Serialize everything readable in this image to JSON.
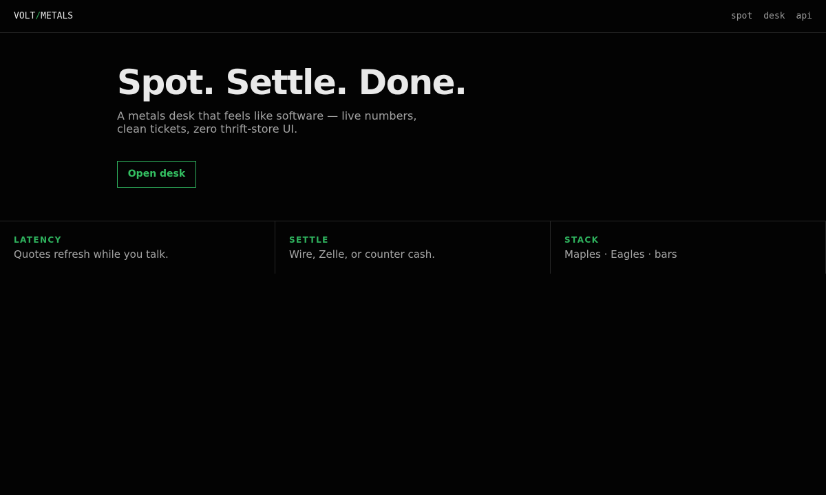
{
  "brand": {
    "left": "VOLT",
    "separator": "/",
    "right": "METALS"
  },
  "nav": [
    {
      "label": "spot"
    },
    {
      "label": "desk"
    },
    {
      "label": "api"
    }
  ],
  "hero": {
    "title": "Spot. Settle. Done.",
    "subtitle": "A metals desk that feels like software — live numbers, clean tickets, zero thrift-store UI.",
    "cta_label": "Open desk"
  },
  "features": [
    {
      "key": "LATENCY",
      "text": "Quotes refresh while you talk."
    },
    {
      "key": "SETTLE",
      "text": "Wire, Zelle, or counter cash."
    },
    {
      "key": "STACK",
      "text": "Maples · Eagles · bars"
    }
  ],
  "colors": {
    "background": "#030303",
    "accent": "#2fb35e",
    "text": "#e9e9e9",
    "muted": "#a3a3a3",
    "divider": "#262626"
  }
}
